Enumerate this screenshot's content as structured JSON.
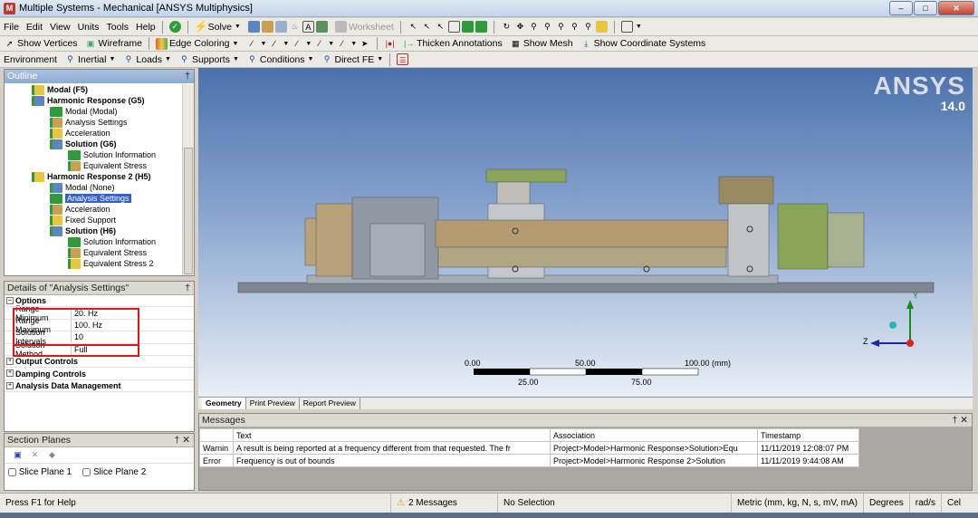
{
  "window": {
    "title": "Multiple Systems - Mechanical [ANSYS Multiphysics]"
  },
  "menu": [
    "File",
    "Edit",
    "View",
    "Units",
    "Tools",
    "Help"
  ],
  "toolbar1": {
    "solve": "Solve",
    "worksheet": "Worksheet"
  },
  "toolbar2": {
    "show_vertices": "Show Vertices",
    "wireframe": "Wireframe",
    "edge_coloring": "Edge Coloring",
    "thicken_annotations": "Thicken Annotations",
    "show_mesh": "Show Mesh",
    "show_coordinate_systems": "Show Coordinate Systems"
  },
  "toolbar3": {
    "environment": "Environment",
    "inertial": "Inertial",
    "loads": "Loads",
    "supports": "Supports",
    "conditions": "Conditions",
    "direct_fe": "Direct FE"
  },
  "outline": {
    "title": "Outline",
    "items": [
      {
        "label": "Modal (F5)",
        "bold": true,
        "indent": 1
      },
      {
        "label": "Harmonic Response (G5)",
        "bold": true,
        "indent": 1
      },
      {
        "label": "Modal (Modal)",
        "indent": 2
      },
      {
        "label": "Analysis Settings",
        "indent": 2
      },
      {
        "label": "Acceleration",
        "indent": 2
      },
      {
        "label": "Solution (G6)",
        "bold": true,
        "indent": 2
      },
      {
        "label": "Solution Information",
        "indent": 3
      },
      {
        "label": "Equivalent Stress",
        "indent": 3
      },
      {
        "label": "Harmonic Response 2 (H5)",
        "bold": true,
        "indent": 1
      },
      {
        "label": "Modal (None)",
        "indent": 2
      },
      {
        "label": "Analysis Settings",
        "indent": 2,
        "selected": true
      },
      {
        "label": "Acceleration",
        "indent": 2
      },
      {
        "label": "Fixed Support",
        "indent": 2
      },
      {
        "label": "Solution (H6)",
        "bold": true,
        "indent": 2
      },
      {
        "label": "Solution Information",
        "indent": 3
      },
      {
        "label": "Equivalent Stress",
        "indent": 3
      },
      {
        "label": "Equivalent Stress 2",
        "indent": 3
      }
    ]
  },
  "details": {
    "title": "Details of \"Analysis Settings\"",
    "options_label": "Options",
    "rows": [
      {
        "label": "Range Minimum",
        "value": "20. Hz"
      },
      {
        "label": "Range Maximum",
        "value": "100. Hz"
      },
      {
        "label": "Solution Intervals",
        "value": "10"
      },
      {
        "label": "Solution Method",
        "value": "Full"
      }
    ],
    "groups": [
      "Output Controls",
      "Damping Controls",
      "Analysis Data Management"
    ]
  },
  "section_planes": {
    "title": "Section Planes",
    "items": [
      "Slice Plane 1",
      "Slice Plane 2"
    ]
  },
  "viewport": {
    "brand": "ANSYS",
    "version": "14.0",
    "scale_labels_top": [
      "0.00",
      "50.00",
      "100.00 (mm)"
    ],
    "scale_labels_bottom": [
      "25.00",
      "75.00"
    ],
    "axis_z": "Z",
    "axis_y": "Y"
  },
  "view_tabs": [
    "Geometry",
    "Print Preview",
    "Report Preview"
  ],
  "messages": {
    "title": "Messages",
    "headers": [
      "",
      "Text",
      "Association",
      "Timestamp"
    ],
    "rows": [
      [
        "Warnin",
        "A result is being reported at a frequency different from that requested.  The fr",
        "Project>Model>Harmonic Response>Solution>Equ",
        "11/11/2019 12:08:07 PM"
      ],
      [
        "Error",
        "Frequency is out of bounds",
        "Project>Model>Harmonic Response 2>Solution",
        "11/11/2019 9:44:08 AM"
      ]
    ]
  },
  "status": {
    "help": "Press F1 for Help",
    "messages": "2 Messages",
    "selection": "No Selection",
    "units": "Metric (mm, kg, N, s, mV, mA)",
    "angle": "Degrees",
    "rate": "rad/s",
    "temp": "Cel"
  }
}
